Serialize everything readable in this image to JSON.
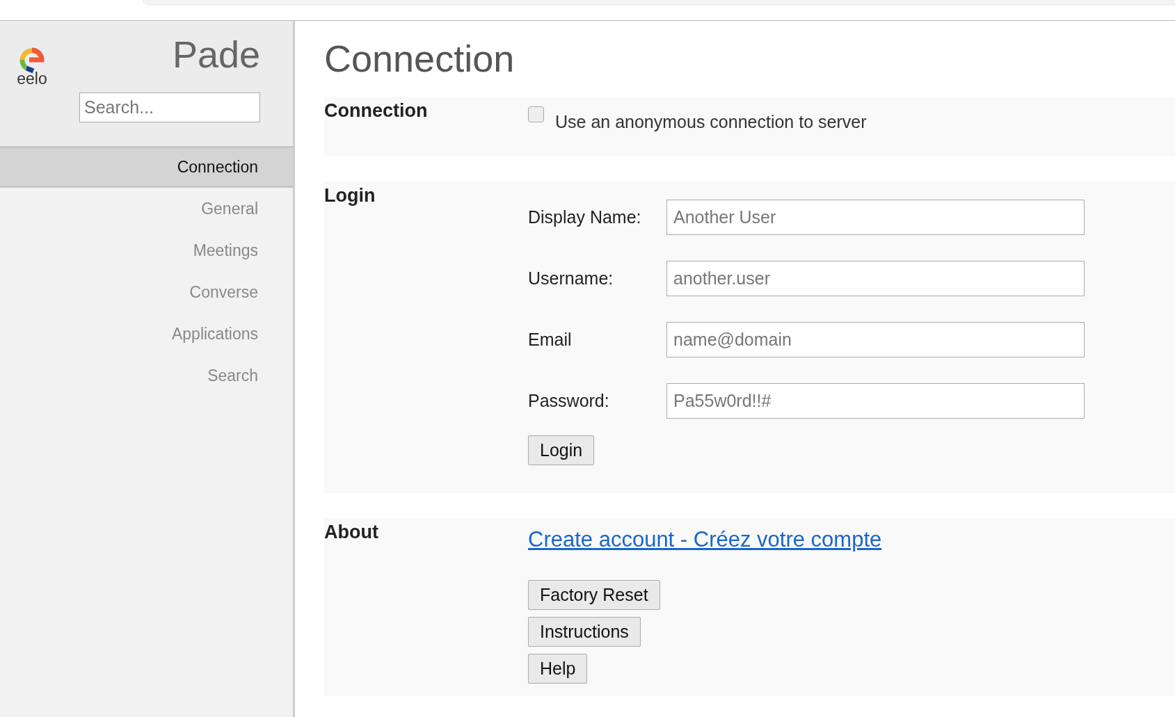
{
  "sidebar": {
    "title": "Pade",
    "logo_text": "eelo",
    "search": {
      "placeholder": "Search..."
    },
    "items": [
      {
        "label": "Connection",
        "selected": true
      },
      {
        "label": "General",
        "selected": false
      },
      {
        "label": "Meetings",
        "selected": false
      },
      {
        "label": "Converse",
        "selected": false
      },
      {
        "label": "Applications",
        "selected": false
      },
      {
        "label": "Search",
        "selected": false
      }
    ]
  },
  "page_title": "Connection",
  "sections": [
    {
      "title": "Connection",
      "kind": "checkbox",
      "checkbox": {
        "label": "Use an anonymous connection to server",
        "checked": false
      }
    },
    {
      "title": "Login",
      "kind": "form",
      "fields": [
        {
          "label": "Display Name:",
          "placeholder": "Another User"
        },
        {
          "label": "Username:",
          "placeholder": "another.user"
        },
        {
          "label": "Email",
          "placeholder": "name@domain"
        },
        {
          "label": "Password:",
          "placeholder": "Pa55w0rd!!#"
        }
      ],
      "button": "Login"
    },
    {
      "title": "About",
      "kind": "about",
      "link": "Create account - Créez votre compte",
      "buttons": [
        "Factory Reset",
        "Instructions",
        "Help"
      ]
    }
  ]
}
